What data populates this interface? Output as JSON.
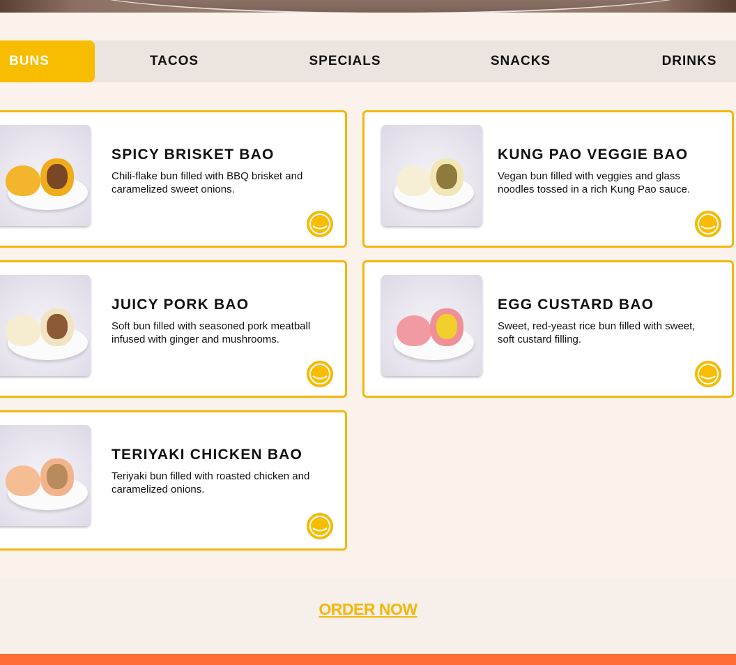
{
  "tabs": [
    {
      "label": "BUNS",
      "active": true
    },
    {
      "label": "TACOS",
      "active": false
    },
    {
      "label": "SPECIALS",
      "active": false
    },
    {
      "label": "SNACKS",
      "active": false
    },
    {
      "label": "DRINKS",
      "active": false
    }
  ],
  "menu_items": [
    {
      "title": "SPICY BRISKET BAO",
      "description": "Chili-flake bun filled with BBQ brisket and caramelized sweet onions.",
      "image_icon": "bao-photo"
    },
    {
      "title": "KUNG PAO VEGGIE BAO",
      "description": "Vegan bun filled with veggies and glass noodles tossed in a rich Kung Pao sauce.",
      "image_icon": "bao-photo"
    },
    {
      "title": "JUICY PORK BAO",
      "description": "Soft bun filled with seasoned pork meatball infused with ginger and mushrooms.",
      "image_icon": "bao-photo"
    },
    {
      "title": "EGG CUSTARD BAO",
      "description": "Sweet, red-yeast rice bun filled with sweet, soft custard filling.",
      "image_icon": "bao-photo"
    },
    {
      "title": "TERIYAKI CHICKEN BAO",
      "description": "Teriyaki bun filled with roasted chicken and caramelized onions.",
      "image_icon": "bao-photo"
    }
  ],
  "order": {
    "label": "ORDER NOW"
  },
  "colors": {
    "accent": "#f8bd00",
    "card_border": "#f3b70a",
    "background": "#faf2eb",
    "footer": "#ff6c35"
  }
}
